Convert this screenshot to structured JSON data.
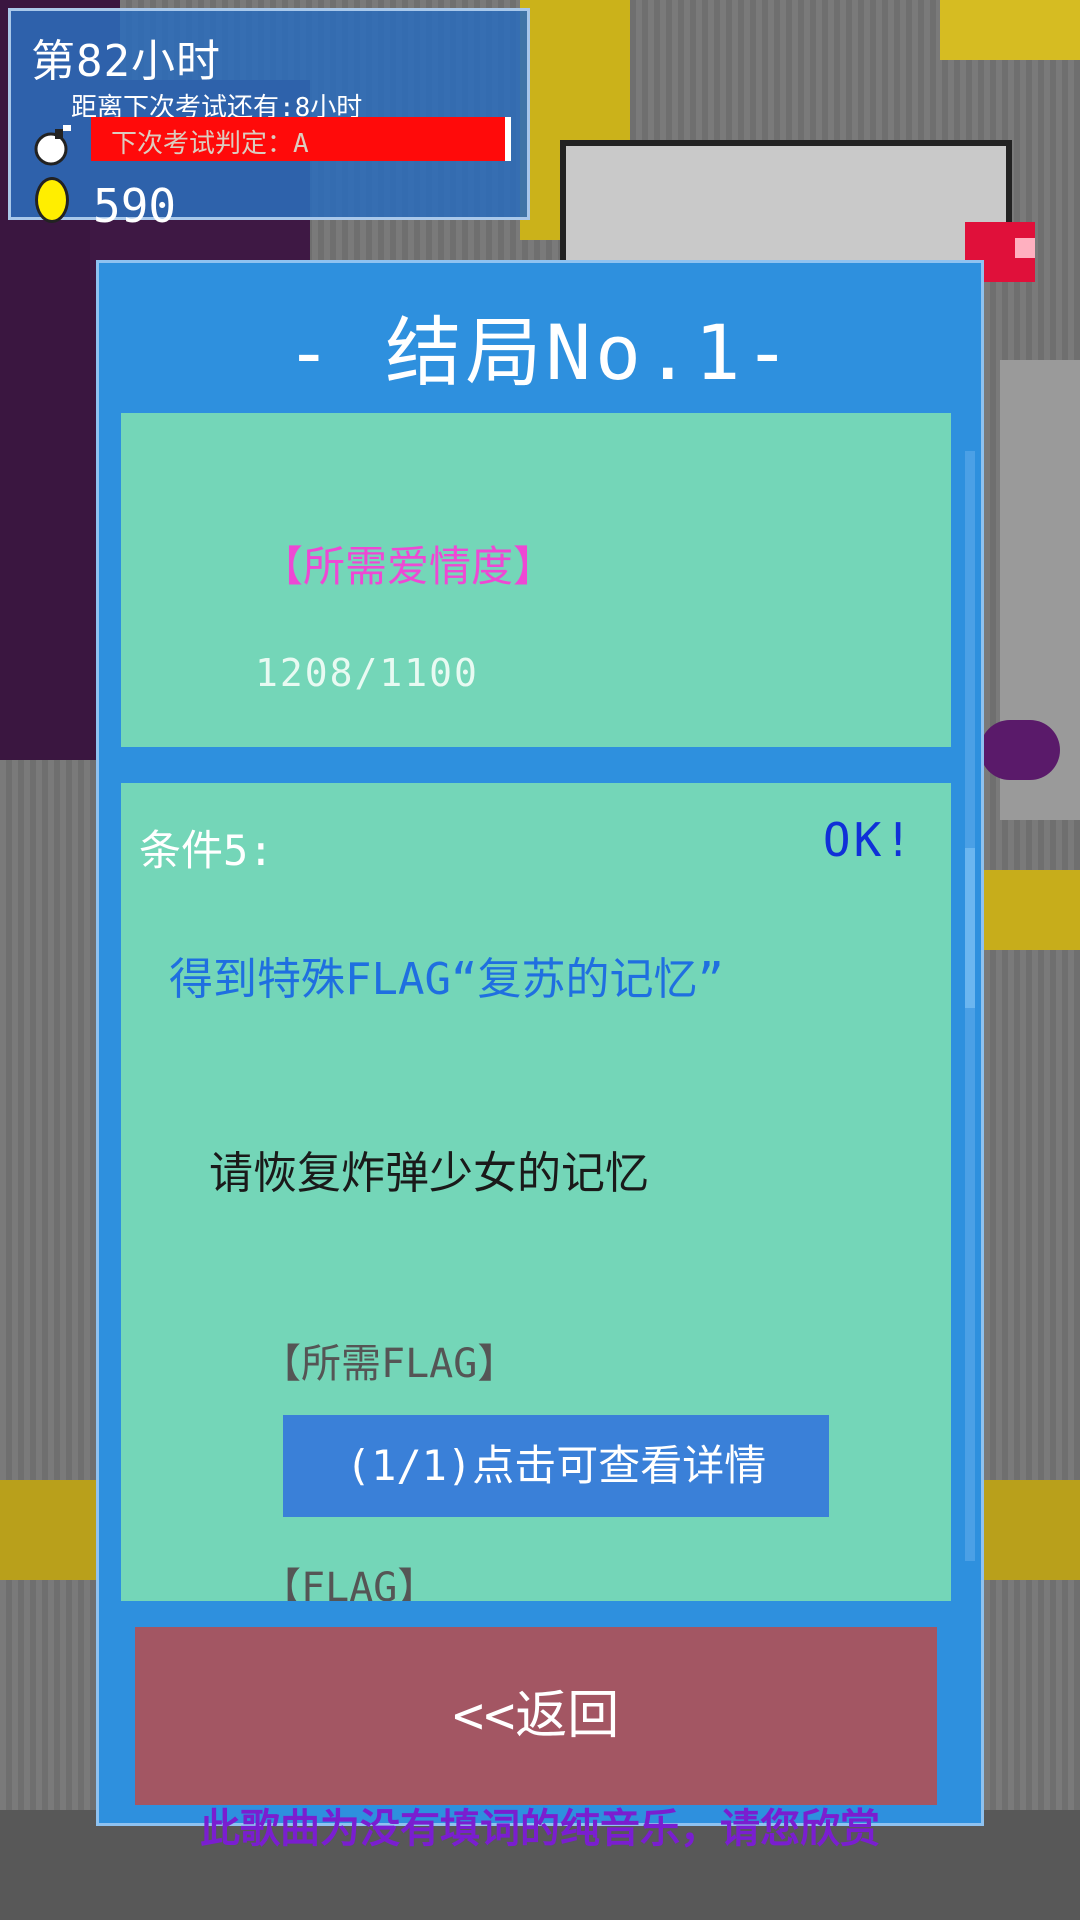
{
  "hud": {
    "hours": "第82小时",
    "next_exam_countdown": "距离下次考试还有:8小时",
    "next_exam_grade": "下次考试判定：A",
    "coins": "590",
    "bomb_icon": "bomb-icon",
    "coin_icon": "coin-icon"
  },
  "panel": {
    "title": "- 结局No.1-",
    "required_love_label": "【所需爱情度】",
    "required_love_value": "1208/1100",
    "condition_label": "条件5:",
    "condition_status": "OK!",
    "condition_flag": "得到特殊FLAG“复苏的记忆”",
    "hint": "请恢复炸弹少女的记忆",
    "required_flag_label": "【所需FLAG】",
    "detail_button": "(1/1)点击可查看详情",
    "flag_label": "【FLAG】",
    "back_button": "<<返回"
  },
  "subtitle": "此歌曲为没有填词的纯音乐，请您欣赏",
  "colors": {
    "panel": "#2e90de",
    "card": "#74d6b8",
    "love_label": "#ee48d4",
    "ok": "#1030d8",
    "flag_text": "#1f6fe0",
    "back_button": "#a35663",
    "detail_button": "#3a80d8",
    "exam_bar": "#ff0a0a",
    "subtitle": "#7a1ed0"
  }
}
